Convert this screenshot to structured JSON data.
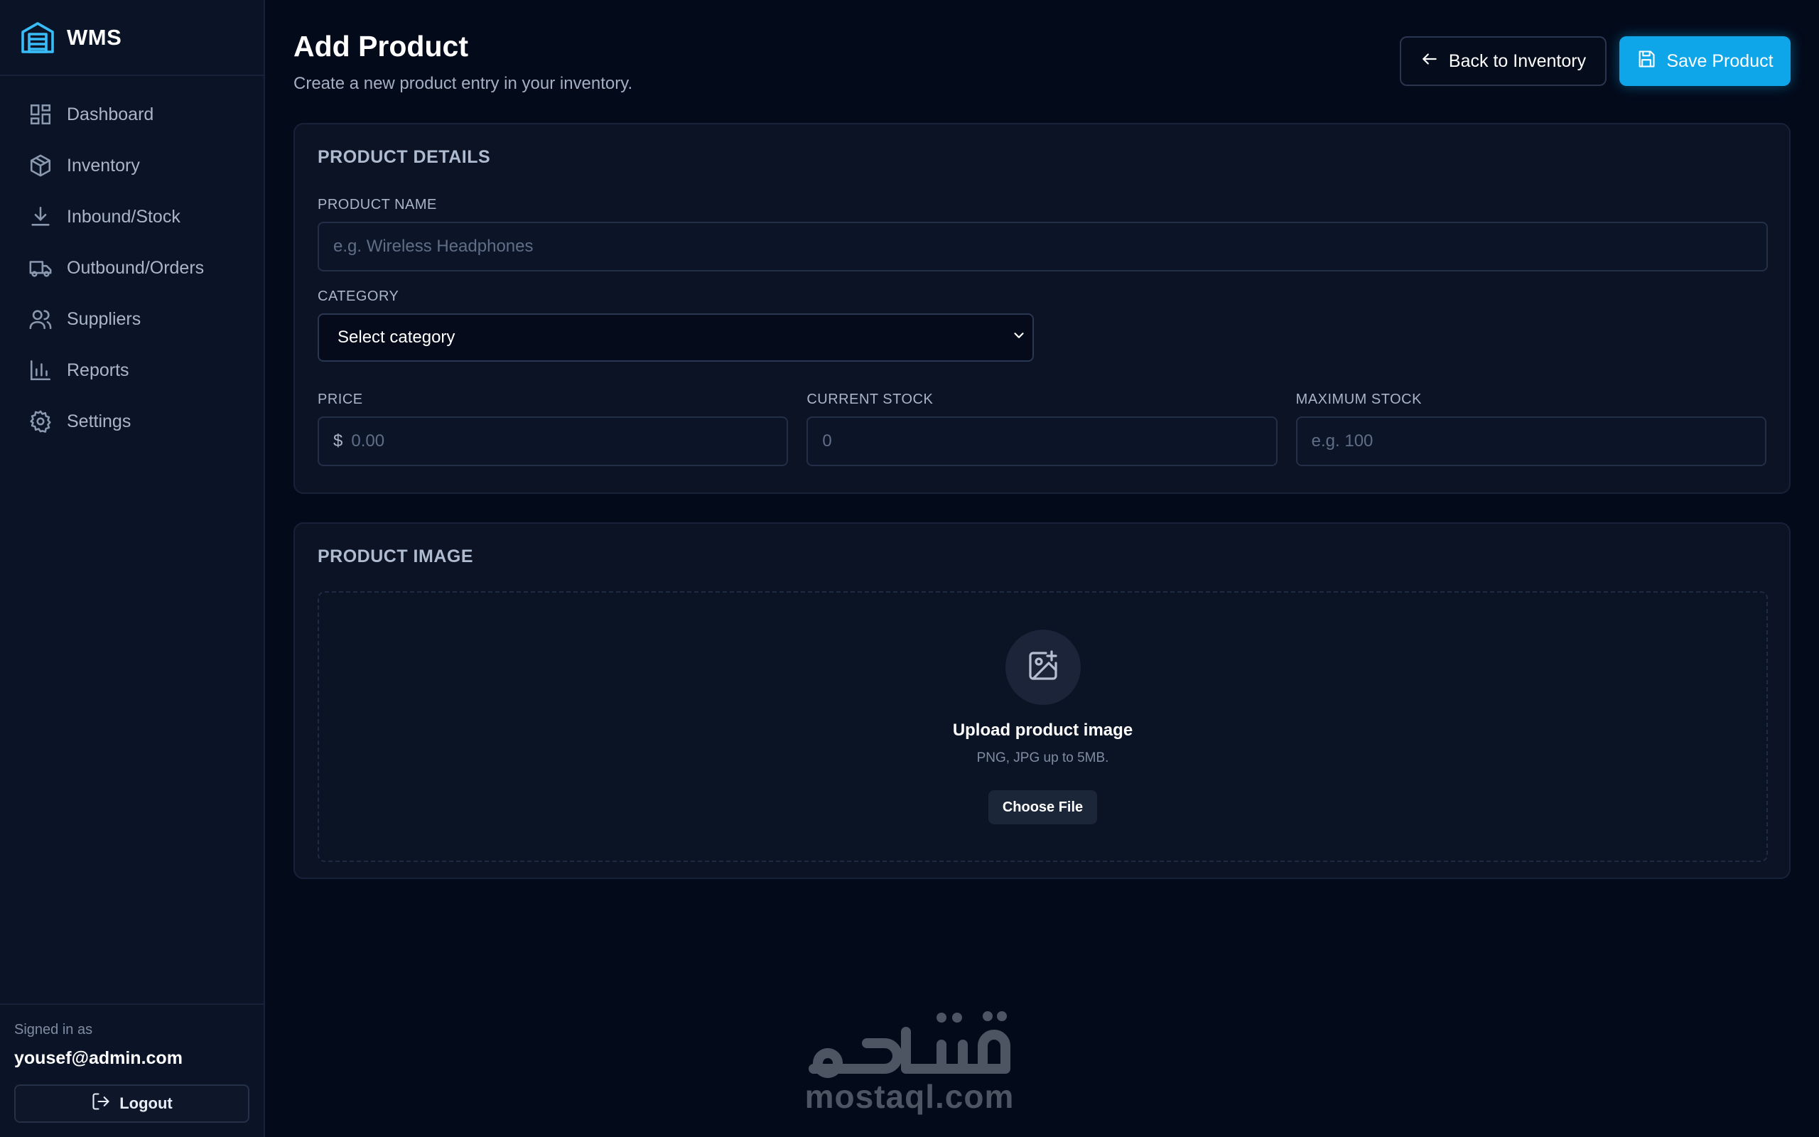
{
  "brand": {
    "name": "WMS"
  },
  "sidebar": {
    "items": [
      {
        "label": "Dashboard",
        "icon": "dashboard-icon"
      },
      {
        "label": "Inventory",
        "icon": "box-icon"
      },
      {
        "label": "Inbound/Stock",
        "icon": "download-icon"
      },
      {
        "label": "Outbound/Orders",
        "icon": "truck-icon"
      },
      {
        "label": "Suppliers",
        "icon": "users-icon"
      },
      {
        "label": "Reports",
        "icon": "bar-chart-icon"
      },
      {
        "label": "Settings",
        "icon": "gear-icon"
      }
    ]
  },
  "user": {
    "signed_in_label": "Signed in as",
    "email": "yousef@admin.com",
    "logout_label": "Logout"
  },
  "header": {
    "title": "Add Product",
    "subtitle": "Create a new product entry in your inventory.",
    "back_label": "Back to Inventory",
    "save_label": "Save Product"
  },
  "details": {
    "section_title": "PRODUCT DETAILS",
    "product_name": {
      "label": "PRODUCT NAME",
      "placeholder": "e.g. Wireless Headphones",
      "value": ""
    },
    "category": {
      "label": "CATEGORY",
      "value": "Select category"
    },
    "price": {
      "label": "PRICE",
      "prefix": "$",
      "placeholder": "0.00"
    },
    "current_stock": {
      "label": "CURRENT STOCK",
      "placeholder": "0"
    },
    "maximum_stock": {
      "label": "MAXIMUM STOCK",
      "placeholder": "e.g. 100"
    }
  },
  "image": {
    "section_title": "PRODUCT IMAGE",
    "upload_title": "Upload product image",
    "upload_hint": "PNG, JPG up to 5MB.",
    "choose_label": "Choose File"
  },
  "watermark": {
    "text": "mostaql.com"
  },
  "colors": {
    "accent": "#0ea5e9",
    "background": "#030a1a",
    "sidebar": "#0b1426",
    "card": "#0b1324"
  }
}
